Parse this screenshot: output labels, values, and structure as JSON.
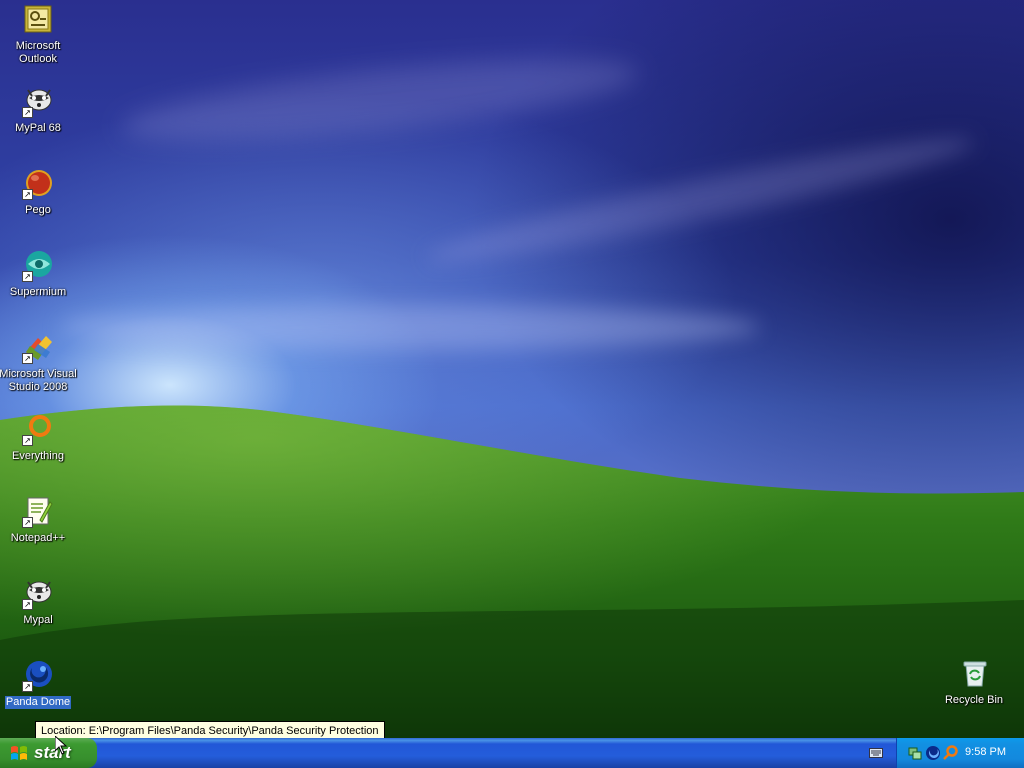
{
  "desktop": {
    "icons": [
      {
        "label": "Microsoft\nOutlook",
        "icon": "outlook-icon"
      },
      {
        "label": "MyPal 68",
        "icon": "mypal-icon"
      },
      {
        "label": "Pego",
        "icon": "pego-icon"
      },
      {
        "label": "Supermium",
        "icon": "supermium-icon"
      },
      {
        "label": "Microsoft Visual\nStudio 2008",
        "icon": "visual-studio-icon"
      },
      {
        "label": "Everything",
        "icon": "everything-icon"
      },
      {
        "label": "Notepad++",
        "icon": "notepadpp-icon"
      },
      {
        "label": "Mypal",
        "icon": "mypal-icon"
      },
      {
        "label": "Panda Dome",
        "icon": "panda-dome-icon",
        "selected": true
      },
      {
        "label": "Recycle Bin",
        "icon": "recycle-bin-icon"
      }
    ]
  },
  "tooltip": {
    "text": "Location: E:\\Program Files\\Panda Security\\Panda Security Protection"
  },
  "taskbar": {
    "start_label": "start",
    "clock": "9:58 PM",
    "tray_icons": [
      "network-icon",
      "security-icon",
      "search-icon"
    ]
  },
  "colors": {
    "taskbar_blue": "#245ddb",
    "start_green": "#3c9a31",
    "tray_blue": "#1290e2",
    "selection_blue": "#316ac5",
    "tooltip_bg": "#ffffe1"
  }
}
